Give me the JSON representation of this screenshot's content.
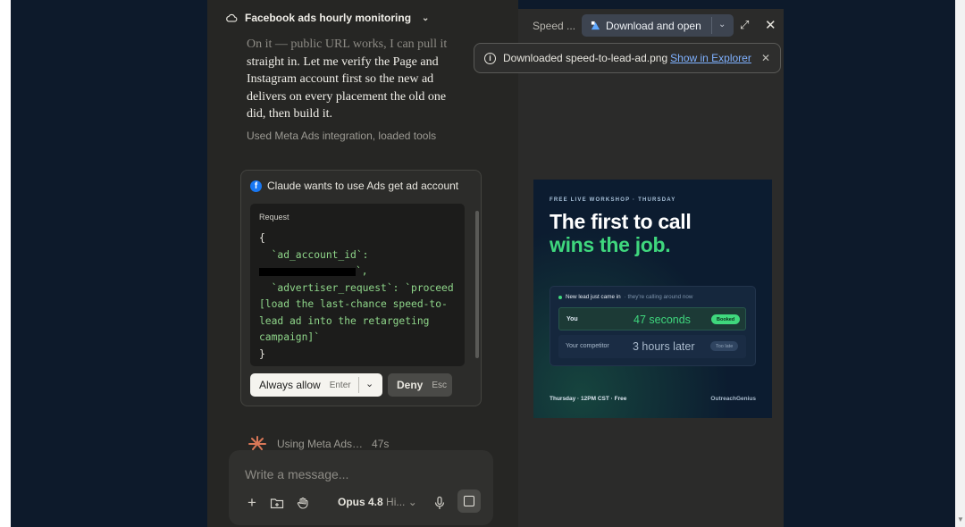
{
  "chat": {
    "title": "Facebook ads hourly monitoring",
    "message_faded": "On it — public URL works, I can pull it",
    "message": "straight in. Let me verify the Page and Instagram account first so the new ad delivers on every placement the old one did, then build it.",
    "used_tools": "Used Meta Ads integration, loaded tools",
    "permission": {
      "title": "Claude wants to use Ads get ad account",
      "request_label": "Request",
      "code_open": "{",
      "code_key1": "  `ad_account_id`:",
      "code_line2_suffix": "`,",
      "code_key2": "  `advertiser_request`: `proceed",
      "code_val2a": "[load the last-chance speed-to-",
      "code_val2b": "lead ad into the retargeting",
      "code_val2c": "campaign]`",
      "code_close": "}",
      "allow_label": "Always allow",
      "allow_key": "Enter",
      "deny_label": "Deny",
      "deny_key": "Esc"
    },
    "working_label": "Using Meta Ads…",
    "working_time": "47s",
    "composer": {
      "placeholder": "Write a message...",
      "model_name": "Opus 4.8",
      "model_sub": "Hi..."
    }
  },
  "preview": {
    "title": "Speed ...",
    "download_label": "Download and open",
    "toast_text": "Downloaded speed-to-lead-ad.png",
    "toast_link": "Show in Explorer"
  },
  "ad": {
    "eyebrow": "FREE LIVE WORKSHOP · THURSDAY",
    "headline1": "The first to call",
    "headline2": "wins the job.",
    "card_header": "New lead just came in",
    "card_header_muted": "· they're calling around now",
    "row1": {
      "who": "You",
      "value": "47 seconds",
      "pill": "Booked"
    },
    "row2": {
      "who": "Your competitor",
      "value": "3 hours later",
      "pill": "Too late"
    },
    "footer_left": "Thursday · 12PM CST · Free",
    "footer_right": "OutreachGenius"
  },
  "colors": {
    "accent_green": "#3fd77d",
    "link_blue": "#7fb1ff",
    "facebook_blue": "#1877f2"
  }
}
